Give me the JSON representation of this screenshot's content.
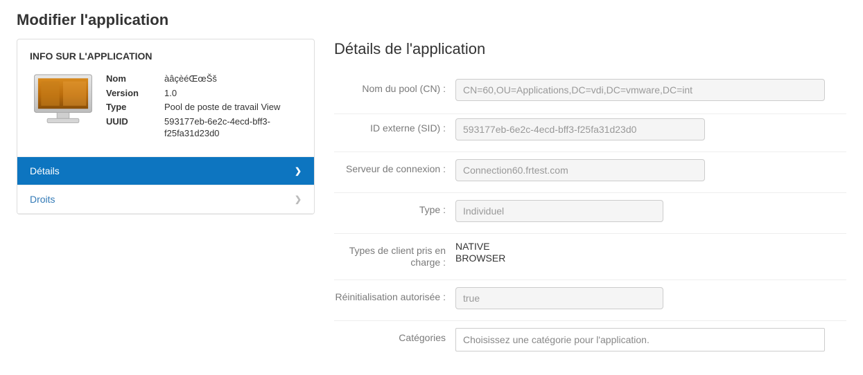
{
  "page_title": "Modifier l'application",
  "info_panel": {
    "header": "INFO SUR L'APPLICATION",
    "name_label": "Nom",
    "version_label": "Version",
    "type_label": "Type",
    "uuid_label": "UUID",
    "name": "àâçèéŒœŠš",
    "version": "1.0",
    "type": "Pool de poste de travail View",
    "uuid": "593177eb-6e2c-4ecd-bff3-f25fa31d23d0"
  },
  "nav": {
    "details": "Détails",
    "rights": "Droits"
  },
  "section_title": "Détails de l'application",
  "form": {
    "pool_cn_label": "Nom du pool (CN) :",
    "pool_cn_value": "CN=60,OU=Applications,DC=vdi,DC=vmware,DC=int",
    "ext_id_label": "ID externe (SID) :",
    "ext_id_value": "593177eb-6e2c-4ecd-bff3-f25fa31d23d0",
    "conn_server_label": "Serveur de connexion :",
    "conn_server_value": "Connection60.frtest.com",
    "type_label": "Type :",
    "type_value": "Individuel",
    "client_types_label": "Types de client pris en charge :",
    "client_types_value_1": "NATIVE",
    "client_types_value_2": "BROWSER",
    "reset_label": "Réinitialisation autorisée :",
    "reset_value": "true",
    "categories_label": "Catégories",
    "categories_placeholder": "Choisissez une catégorie pour l'application."
  }
}
